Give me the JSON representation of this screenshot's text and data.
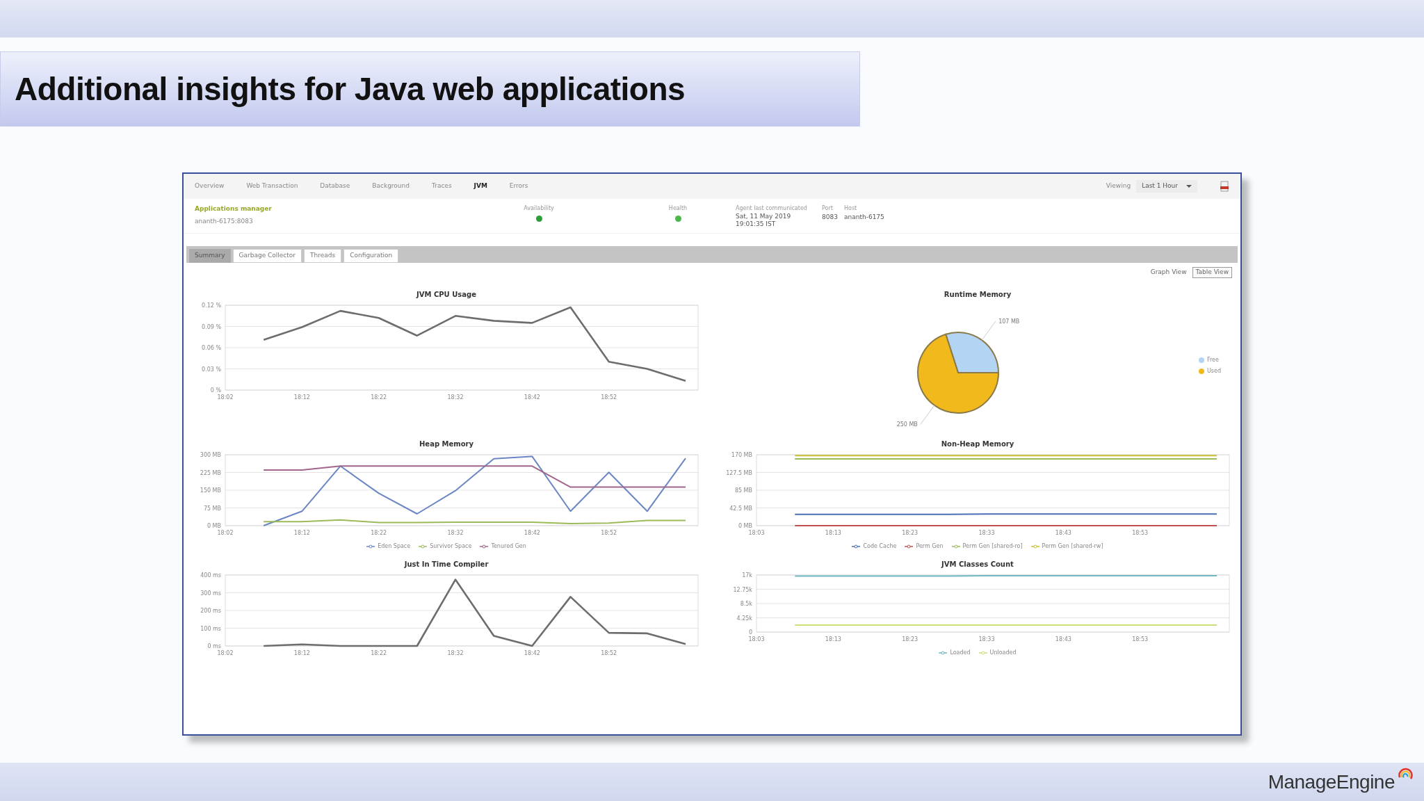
{
  "slide": {
    "title": "Additional insights for Java web applications",
    "logo": "ManageEngine"
  },
  "app": {
    "tabs": [
      {
        "label": "Overview",
        "selected": false
      },
      {
        "label": "Web Transaction",
        "selected": false
      },
      {
        "label": "Database",
        "selected": false
      },
      {
        "label": "Background",
        "selected": false
      },
      {
        "label": "Traces",
        "selected": false
      },
      {
        "label": "JVM",
        "selected": true
      },
      {
        "label": "Errors",
        "selected": false
      }
    ],
    "viewing": {
      "label": "Viewing",
      "value": "Last 1 Hour"
    },
    "info": {
      "name": "Applications manager",
      "instance": "ananth-6175:8083",
      "availability": {
        "label": "Availability",
        "color": "#2e9e3a"
      },
      "health": {
        "label": "Health",
        "color": "#49b847"
      },
      "agent": {
        "label": "Agent last communicated",
        "value": "Sat, 11 May 2019 19:01:35 IST"
      },
      "port": {
        "label": "Port",
        "value": "8083"
      },
      "host": {
        "label": "Host",
        "value": "ananth-6175"
      }
    },
    "subtabs": [
      {
        "label": "Summary",
        "selected": true
      },
      {
        "label": "Garbage Collector",
        "selected": false
      },
      {
        "label": "Threads",
        "selected": false
      },
      {
        "label": "Configuration",
        "selected": false
      }
    ],
    "views": [
      {
        "label": "Graph View",
        "selected": true
      },
      {
        "label": "Table View",
        "selected": false
      }
    ],
    "charts": [
      {
        "chart_data": {
          "type": "line",
          "grid": true,
          "title": "JVM CPU Usage",
          "categories": [
            "18:02",
            null,
            "18:12",
            null,
            "18:22",
            null,
            "18:32",
            null,
            "18:42",
            null,
            "18:52",
            null,
            null
          ],
          "ylim": [
            0,
            0.12
          ],
          "yticks": [
            {
              "value": 0,
              "label": "0 %"
            },
            {
              "value": 0.03,
              "label": "0.03 %"
            },
            {
              "value": 0.06,
              "label": "0.06 %"
            },
            {
              "value": 0.09,
              "label": "0.09 %"
            },
            {
              "value": 0.12,
              "label": "0.12 %"
            }
          ],
          "series": [
            {
              "color": "#6d6d6d",
              "values": [
                null,
                0.071,
                0.089,
                0.112,
                0.102,
                0.077,
                0.105,
                0.098,
                0.095,
                0.117,
                0.04,
                0.03,
                0.013
              ]
            }
          ]
        }
      },
      {
        "chart_data": {
          "type": "pie",
          "title": "Runtime Memory",
          "categories": [
            "Free",
            "Used"
          ],
          "values": [
            107,
            250
          ],
          "colors": [
            "#b3d4f2",
            "#f2b91c"
          ],
          "value_labels": [
            "107 MB",
            "250 MB"
          ]
        }
      },
      {
        "chart_data": {
          "type": "line",
          "grid": true,
          "title": "Heap Memory",
          "categories": [
            "18:02",
            null,
            "18:12",
            null,
            "18:22",
            null,
            "18:32",
            null,
            "18:42",
            null,
            "18:52",
            null,
            null
          ],
          "ylim": [
            0,
            300
          ],
          "yticks": [
            {
              "value": 0,
              "label": "0 MB"
            },
            {
              "value": 75,
              "label": "75 MB"
            },
            {
              "value": 150,
              "label": "150 MB"
            },
            {
              "value": 225,
              "label": "225 MB"
            },
            {
              "value": 300,
              "label": "300 MB"
            }
          ],
          "series": [
            {
              "name": "Eden Space",
              "color": "#6b86c4",
              "values": [
                null,
                0,
                61,
                252,
                137,
                50,
                148,
                283,
                293,
                61,
                226,
                61,
                285
              ]
            },
            {
              "name": "Survivor Space",
              "color": "#9bbb59",
              "values": [
                null,
                17,
                17,
                24,
                13,
                13,
                15,
                15,
                15,
                9,
                11,
                22,
                22
              ]
            },
            {
              "name": "Tenured Gen",
              "color": "#a0668c",
              "values": [
                null,
                235,
                235,
                252,
                252,
                252,
                252,
                252,
                252,
                163,
                163,
                163,
                163
              ]
            }
          ]
        }
      },
      {
        "chart_data": {
          "type": "line",
          "grid": true,
          "title": "Non-Heap Memory",
          "categories": [
            "18:03",
            null,
            "18:13",
            null,
            "18:23",
            null,
            "18:33",
            null,
            "18:43",
            null,
            "18:53",
            null,
            null
          ],
          "ylim": [
            0,
            170
          ],
          "yticks": [
            {
              "value": 0,
              "label": "0 MB"
            },
            {
              "value": 42.5,
              "label": "42.5 MB"
            },
            {
              "value": 85,
              "label": "85 MB"
            },
            {
              "value": 127.5,
              "label": "127.5 MB"
            },
            {
              "value": 170,
              "label": "170 MB"
            }
          ],
          "series": [
            {
              "name": "Code Cache",
              "color": "#4a6fb5",
              "values": [
                null,
                27,
                27,
                27,
                27,
                27,
                28,
                28,
                28,
                28,
                28,
                28,
                28
              ]
            },
            {
              "name": "Perm Gen",
              "color": "#c0504d",
              "values": [
                null,
                0,
                0,
                0,
                0,
                0,
                0,
                0,
                0,
                0,
                0,
                0,
                0
              ]
            },
            {
              "name": "Perm Gen [shared-ro]",
              "color": "#9bbb59",
              "values": [
                null,
                160,
                160,
                160,
                160,
                160,
                160,
                160,
                160,
                160,
                160,
                160,
                160
              ]
            },
            {
              "name": "Perm Gen [shared-rw]",
              "color": "#c8c030",
              "values": [
                null,
                168,
                168,
                168,
                168,
                168,
                168,
                168,
                168,
                168,
                168,
                168,
                168
              ]
            }
          ]
        }
      },
      {
        "chart_data": {
          "type": "line",
          "grid": true,
          "title": "Just In Time Compiler",
          "categories": [
            "18:02",
            null,
            "18:12",
            null,
            "18:22",
            null,
            "18:32",
            null,
            "18:42",
            null,
            "18:52",
            null,
            null
          ],
          "ylim": [
            0,
            400
          ],
          "yticks": [
            {
              "value": 0,
              "label": "0 ms"
            },
            {
              "value": 100,
              "label": "100 ms"
            },
            {
              "value": 200,
              "label": "200 ms"
            },
            {
              "value": 300,
              "label": "300 ms"
            },
            {
              "value": 400,
              "label": "400 ms"
            }
          ],
          "series": [
            {
              "color": "#6d6d6d",
              "values": [
                null,
                0,
                9,
                0,
                0,
                0,
                374,
                57,
                0,
                277,
                74,
                71,
                11
              ]
            }
          ]
        }
      },
      {
        "chart_data": {
          "type": "line",
          "grid": true,
          "title": "JVM Classes Count",
          "categories": [
            "18:03",
            null,
            "18:13",
            null,
            "18:23",
            null,
            "18:33",
            null,
            "18:43",
            null,
            "18:53",
            null,
            null
          ],
          "ylim": [
            0,
            17000
          ],
          "yticks": [
            {
              "value": 0,
              "label": "0"
            },
            {
              "value": 4250,
              "label": "4.25k"
            },
            {
              "value": 8500,
              "label": "8.5k"
            },
            {
              "value": 12750,
              "label": "12.75k"
            },
            {
              "value": 17000,
              "label": "17k"
            }
          ],
          "series": [
            {
              "name": "Loaded",
              "color": "#6fb8c4",
              "values": [
                null,
                16700,
                16700,
                16700,
                16700,
                16700,
                16800,
                16800,
                16800,
                16800,
                16800,
                16800,
                16800
              ]
            },
            {
              "name": "Unloaded",
              "color": "#c9e07a",
              "values": [
                null,
                2100,
                2100,
                2100,
                2100,
                2100,
                2100,
                2100,
                2100,
                2100,
                2100,
                2100,
                2100
              ]
            }
          ]
        }
      }
    ]
  }
}
